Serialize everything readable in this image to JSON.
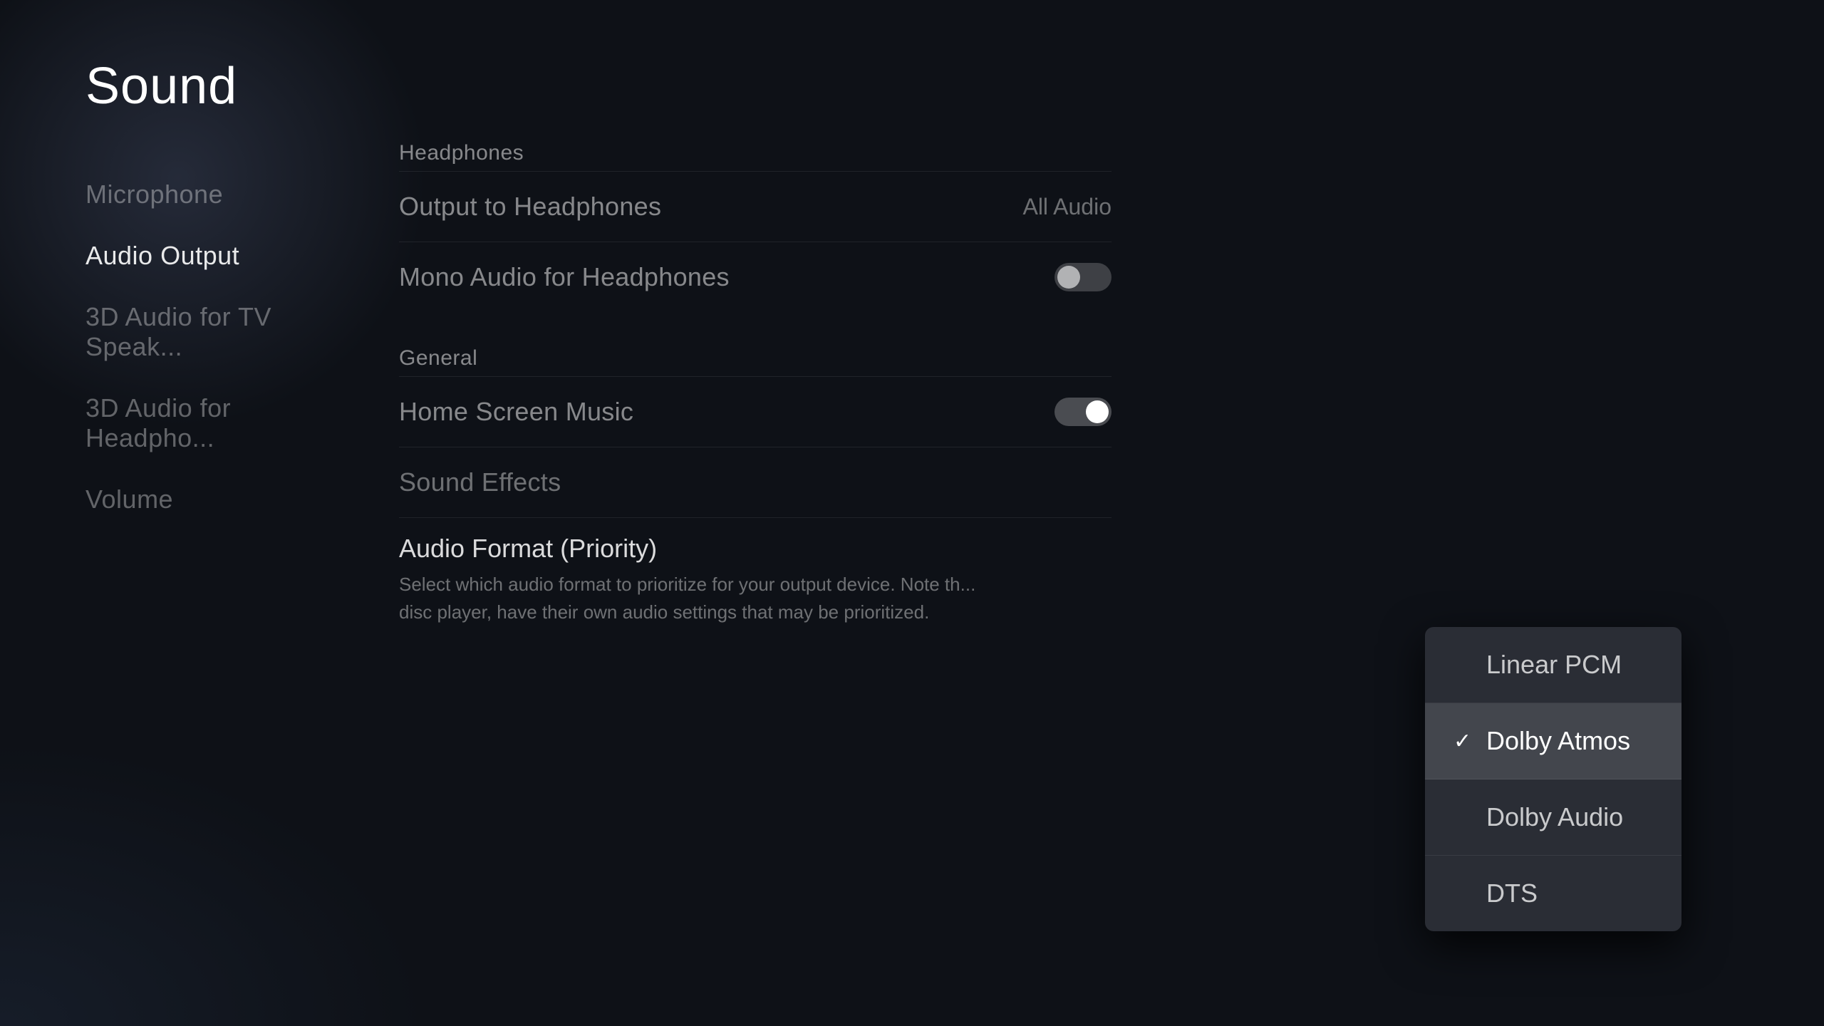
{
  "page": {
    "title": "Sound"
  },
  "sidebar": {
    "items": [
      {
        "id": "microphone",
        "label": "Microphone",
        "active": false
      },
      {
        "id": "audio-output",
        "label": "Audio Output",
        "active": true
      },
      {
        "id": "3d-tv",
        "label": "3D Audio for TV Speak...",
        "active": false
      },
      {
        "id": "3d-headphone",
        "label": "3D Audio for Headpho...",
        "active": false
      },
      {
        "id": "volume",
        "label": "Volume",
        "active": false
      }
    ]
  },
  "sections": {
    "headphones": {
      "header": "Headphones",
      "rows": [
        {
          "id": "output-to-headphones",
          "label": "Output to Headphones",
          "value": "All Audio"
        },
        {
          "id": "mono-audio",
          "label": "Mono Audio for Headphones",
          "toggle": true,
          "toggleOn": false
        }
      ]
    },
    "general": {
      "header": "General",
      "rows": [
        {
          "id": "home-screen-music",
          "label": "Home Screen Music",
          "toggle": true,
          "toggleOn": true
        },
        {
          "id": "sound-effects",
          "label": "Sound Effects",
          "toggle": false
        }
      ]
    },
    "audioFormat": {
      "title": "Audio Format (Priority)",
      "description": "Select which audio format to prioritize for your output device. Note th... disc player, have their own audio settings that may be prioritized."
    }
  },
  "dropdown": {
    "items": [
      {
        "id": "linear-pcm",
        "label": "Linear PCM",
        "selected": false
      },
      {
        "id": "dolby-atmos",
        "label": "Dolby Atmos",
        "selected": true
      },
      {
        "id": "dolby-audio",
        "label": "Dolby Audio",
        "selected": false
      },
      {
        "id": "dts",
        "label": "DTS",
        "selected": false
      }
    ]
  },
  "icons": {
    "check": "✓"
  }
}
